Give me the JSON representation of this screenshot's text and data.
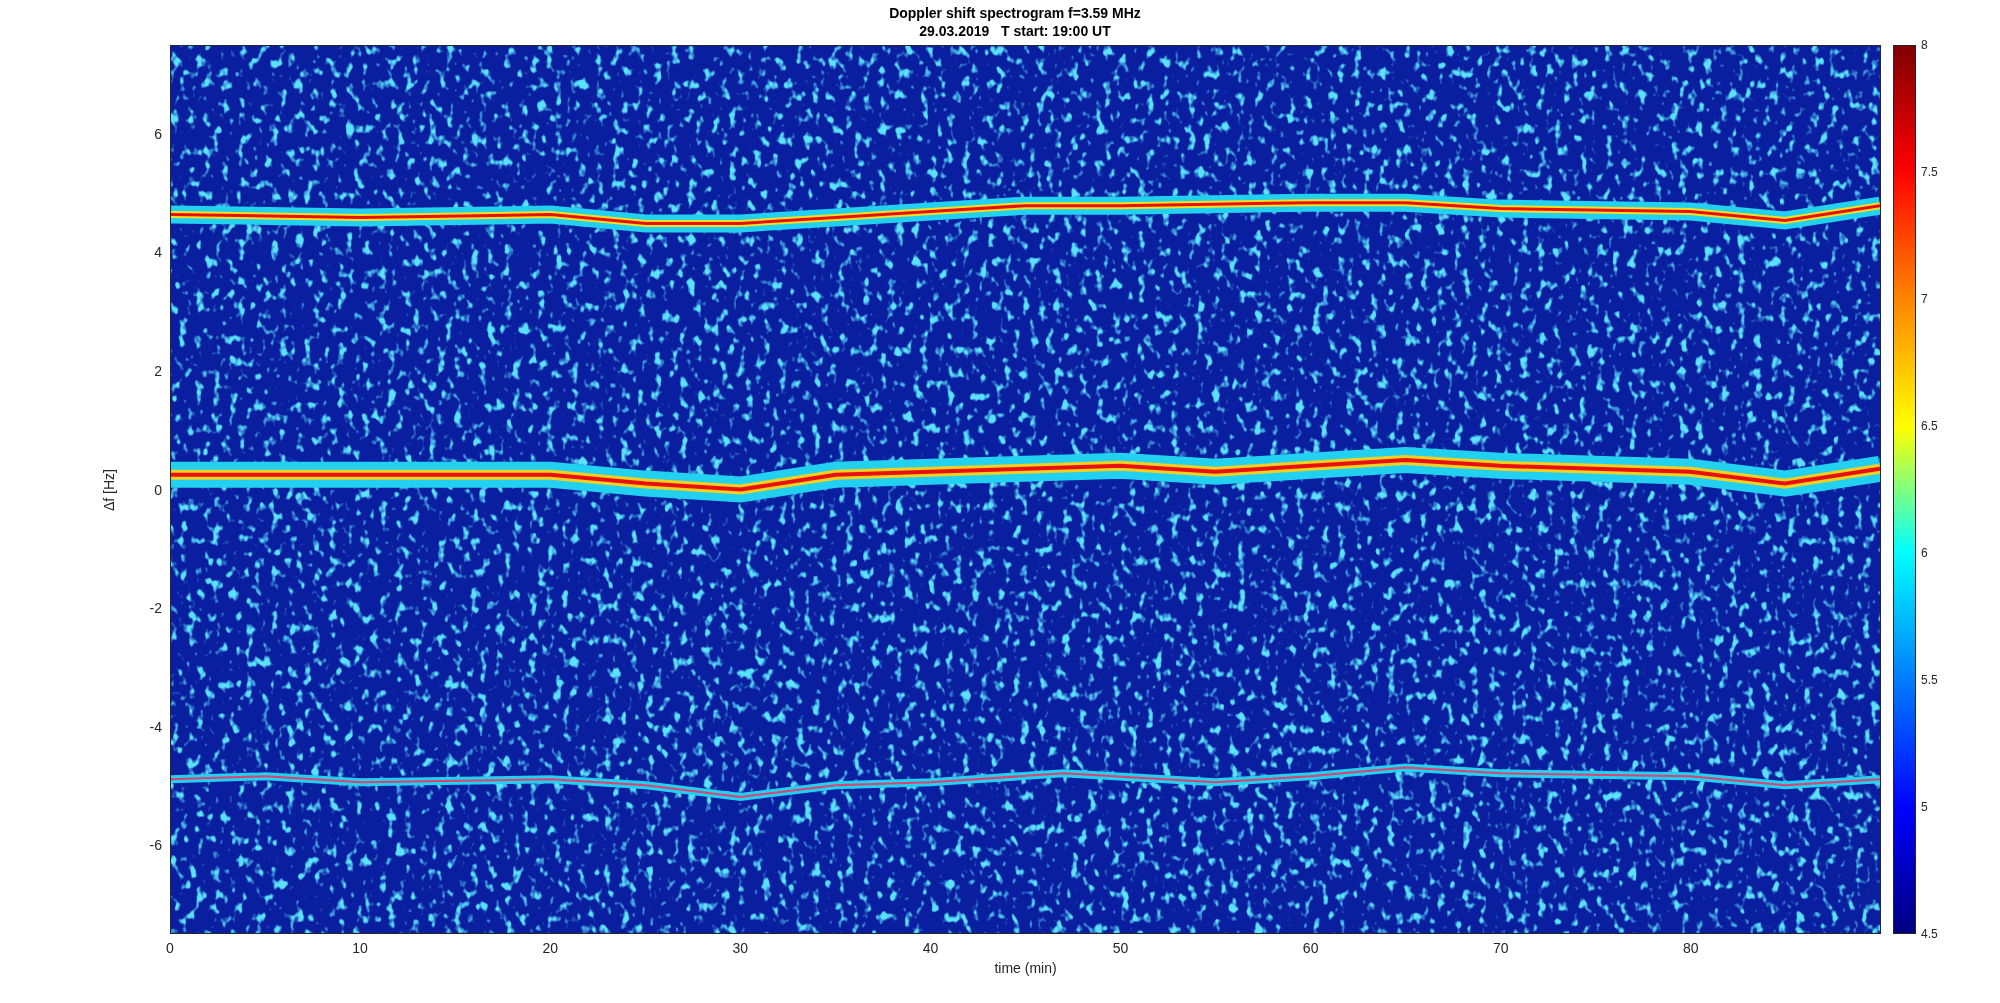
{
  "figure": {
    "title": [
      "Doppler shift spectrogram f=3.59 MHz",
      "29.03.2019   T start: 19:00 UT"
    ],
    "xlabel": "time (min)",
    "ylabel": "Δf [Hz]",
    "xticks": [
      "0",
      "10",
      "20",
      "30",
      "40",
      "50",
      "60",
      "70",
      "80"
    ],
    "yticks": [
      "6",
      "4",
      "2",
      "0",
      "-2",
      "-4",
      "-6"
    ],
    "colorbar_ticks": [
      "8",
      "7.5",
      "7",
      "6.5",
      "6",
      "5.5",
      "5",
      "4.5"
    ]
  }
}
